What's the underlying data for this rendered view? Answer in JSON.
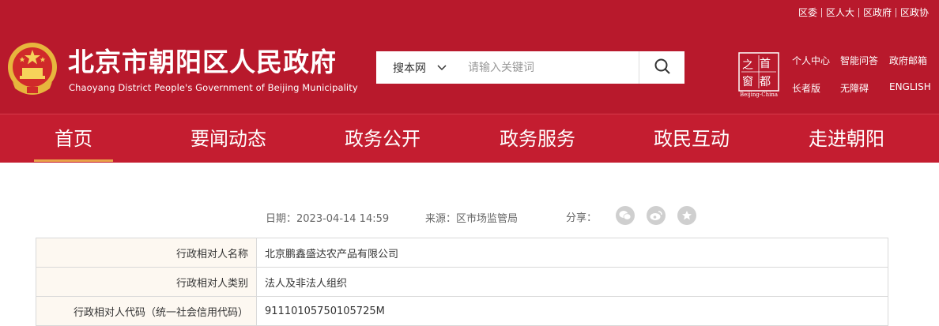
{
  "top_links": [
    "区委",
    "区人大",
    "区政府",
    "区政协"
  ],
  "site": {
    "title": "北京市朝阳区人民政府",
    "subtitle": "Chaoyang District People's Government of Beijing Municipality"
  },
  "search": {
    "scope": "搜本网",
    "placeholder": "请输入关键词"
  },
  "logo": {
    "chars": [
      "首",
      "都",
      "之",
      "窗"
    ],
    "caption": "Beijing-China"
  },
  "quick_links": [
    "个人中心",
    "智能问答",
    "政府邮箱",
    "长者版",
    "无障碍",
    "ENGLISH"
  ],
  "nav": [
    "首页",
    "要闻动态",
    "政务公开",
    "政务服务",
    "政民互动",
    "走进朝阳"
  ],
  "meta": {
    "date": "日期：2023-04-14 14:59",
    "source": "来源：区市场监管局",
    "share_label": "分享："
  },
  "share_icons": [
    "wechat-icon",
    "weibo-icon",
    "favorite-icon"
  ],
  "table": [
    {
      "label": "行政相对人名称",
      "value": "北京鹏鑫盛达农产品有限公司"
    },
    {
      "label": "行政相对人类别",
      "value": "法人及非法人组织"
    },
    {
      "label": "行政相对人代码（统一社会信用代码）",
      "value": "911101057501057 25M"
    }
  ],
  "colors": {
    "header_red": "#b8192c",
    "nav_red": "#c41d30",
    "active_underline": "#e9a34a",
    "label_bg": "#fdf8f1"
  }
}
